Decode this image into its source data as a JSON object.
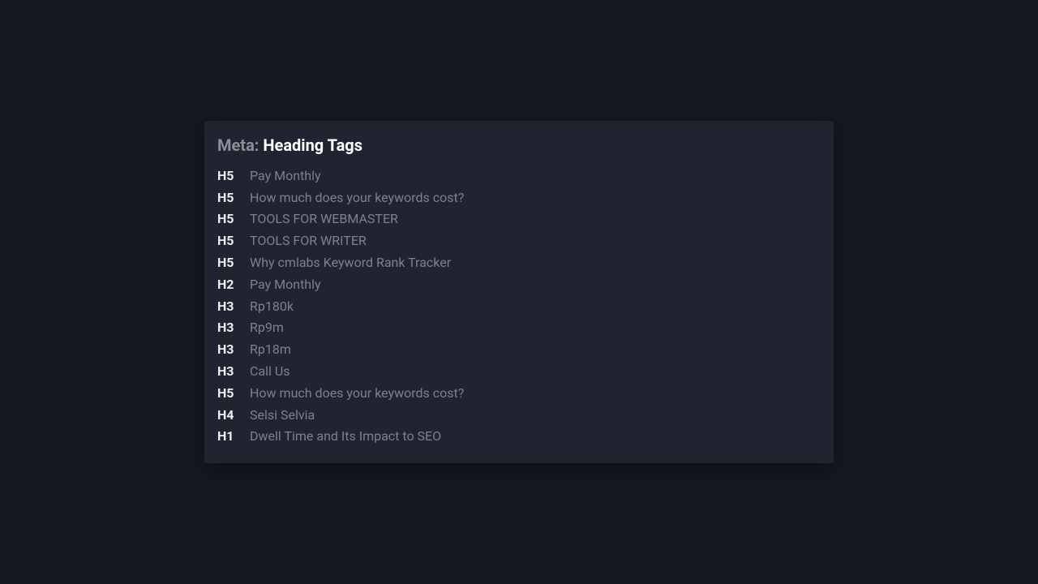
{
  "title": {
    "prefix": "Meta: ",
    "main": "Heading Tags"
  },
  "rows": [
    {
      "tag": "H5",
      "text": "Pay Monthly"
    },
    {
      "tag": "H5",
      "text": "How much does your keywords cost?"
    },
    {
      "tag": "H5",
      "text": "TOOLS FOR WEBMASTER"
    },
    {
      "tag": "H5",
      "text": "TOOLS FOR WRITER"
    },
    {
      "tag": "H5",
      "text": "Why cmlabs Keyword Rank Tracker"
    },
    {
      "tag": "H2",
      "text": "Pay Monthly"
    },
    {
      "tag": "H3",
      "text": "Rp180k"
    },
    {
      "tag": "H3",
      "text": "Rp9m"
    },
    {
      "tag": "H3",
      "text": "Rp18m"
    },
    {
      "tag": "H3",
      "text": "Call Us"
    },
    {
      "tag": "H5",
      "text": "How much does your keywords cost?"
    },
    {
      "tag": "H4",
      "text": "Selsi Selvia"
    },
    {
      "tag": "H1",
      "text": "Dwell Time and Its Impact to SEO"
    }
  ]
}
